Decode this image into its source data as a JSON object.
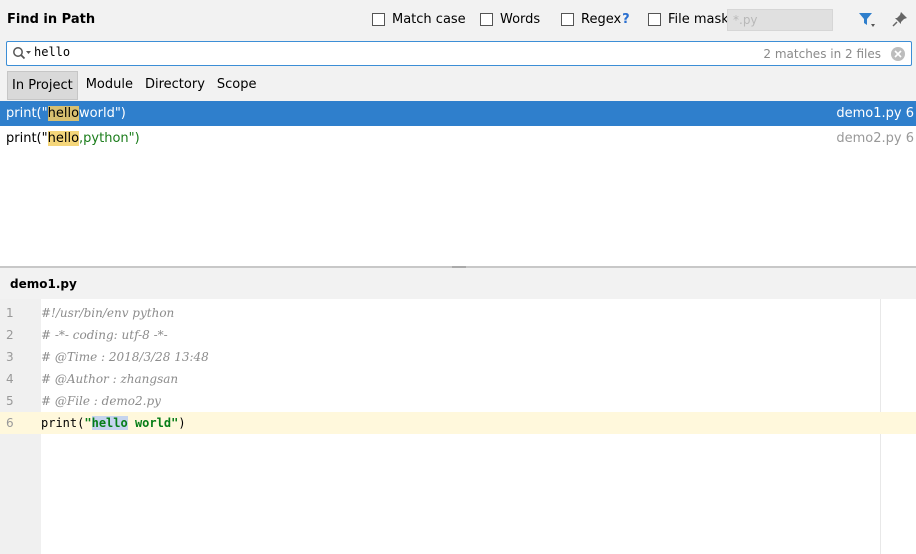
{
  "dialog": {
    "title": "Find in Path"
  },
  "options": {
    "match_case": "Match case",
    "words": "Words",
    "regex": "Regex",
    "regex_help": "?",
    "file_mask": "File mask:",
    "file_mask_placeholder": "*.py"
  },
  "search": {
    "value": "hello",
    "match_count": "2 matches in 2 files"
  },
  "scopes": [
    "In Project",
    "Module",
    "Directory",
    "Scope"
  ],
  "results": [
    {
      "prefix": "print(\"",
      "match": "hello",
      "suffix": " world\")",
      "file": "demo1.py 6"
    },
    {
      "prefix": "print(\"",
      "match": "hello",
      "suffix": ",python\")",
      "file": "demo2.py 6"
    }
  ],
  "preview": {
    "filename": "demo1.py",
    "lines": [
      {
        "num": "1",
        "text": "#!/usr/bin/env python"
      },
      {
        "num": "2",
        "text": "# -*- coding: utf-8 -*-"
      },
      {
        "num": "3",
        "text": "# @Time : 2018/3/28 13:48"
      },
      {
        "num": "4",
        "text": "# @Author : zhangsan"
      },
      {
        "num": "5",
        "text": "# @File : demo2.py"
      },
      {
        "num": "6",
        "prefix": "print(",
        "q1": "\"",
        "match": "hello",
        "rest": " world",
        "q2": "\"",
        "suffix": ")"
      }
    ]
  },
  "colors": {
    "accent": "#2f7fcc",
    "highlight": "#f5d67a",
    "current_line": "#fff8dc"
  }
}
